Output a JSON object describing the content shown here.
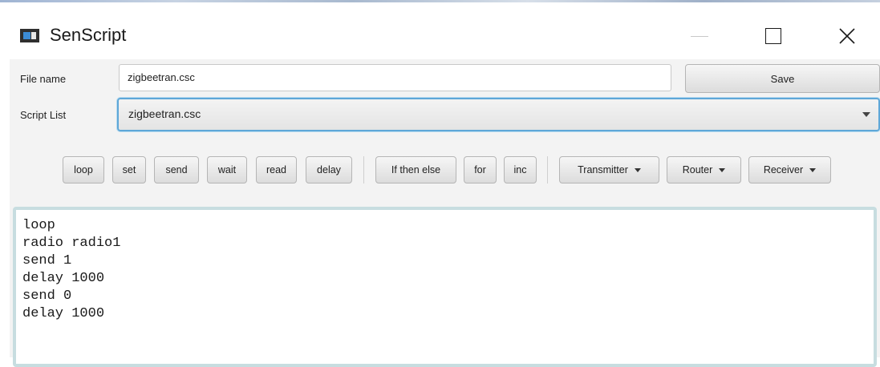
{
  "window": {
    "title": "SenScript"
  },
  "form": {
    "file_name_label": "File name",
    "file_name_value": "zigbeetran.csc",
    "save_label": "Save",
    "script_list_label": "Script List",
    "script_list_selected": "zigbeetran.csc"
  },
  "toolbar": {
    "buttons": [
      {
        "label": "loop"
      },
      {
        "label": "set"
      },
      {
        "label": "send"
      },
      {
        "label": "wait"
      },
      {
        "label": "read"
      },
      {
        "label": "delay"
      },
      {
        "label": "If then else"
      },
      {
        "label": "for"
      },
      {
        "label": "inc"
      },
      {
        "label": "Transmitter"
      },
      {
        "label": "Router"
      },
      {
        "label": "Receiver"
      }
    ]
  },
  "editor": {
    "lines": [
      "loop",
      "radio radio1",
      "send 1",
      "delay 1000",
      "send 0",
      "delay 1000"
    ]
  },
  "colors": {
    "focus_border": "#5ea7d8",
    "editor_border": "#c7dde0",
    "panel_background": "#f3f3f3"
  },
  "icons": {
    "app": "app-window-icon",
    "minimize": "minimize-icon",
    "maximize": "maximize-icon",
    "close": "close-icon",
    "dropdown": "chevron-down-icon"
  }
}
